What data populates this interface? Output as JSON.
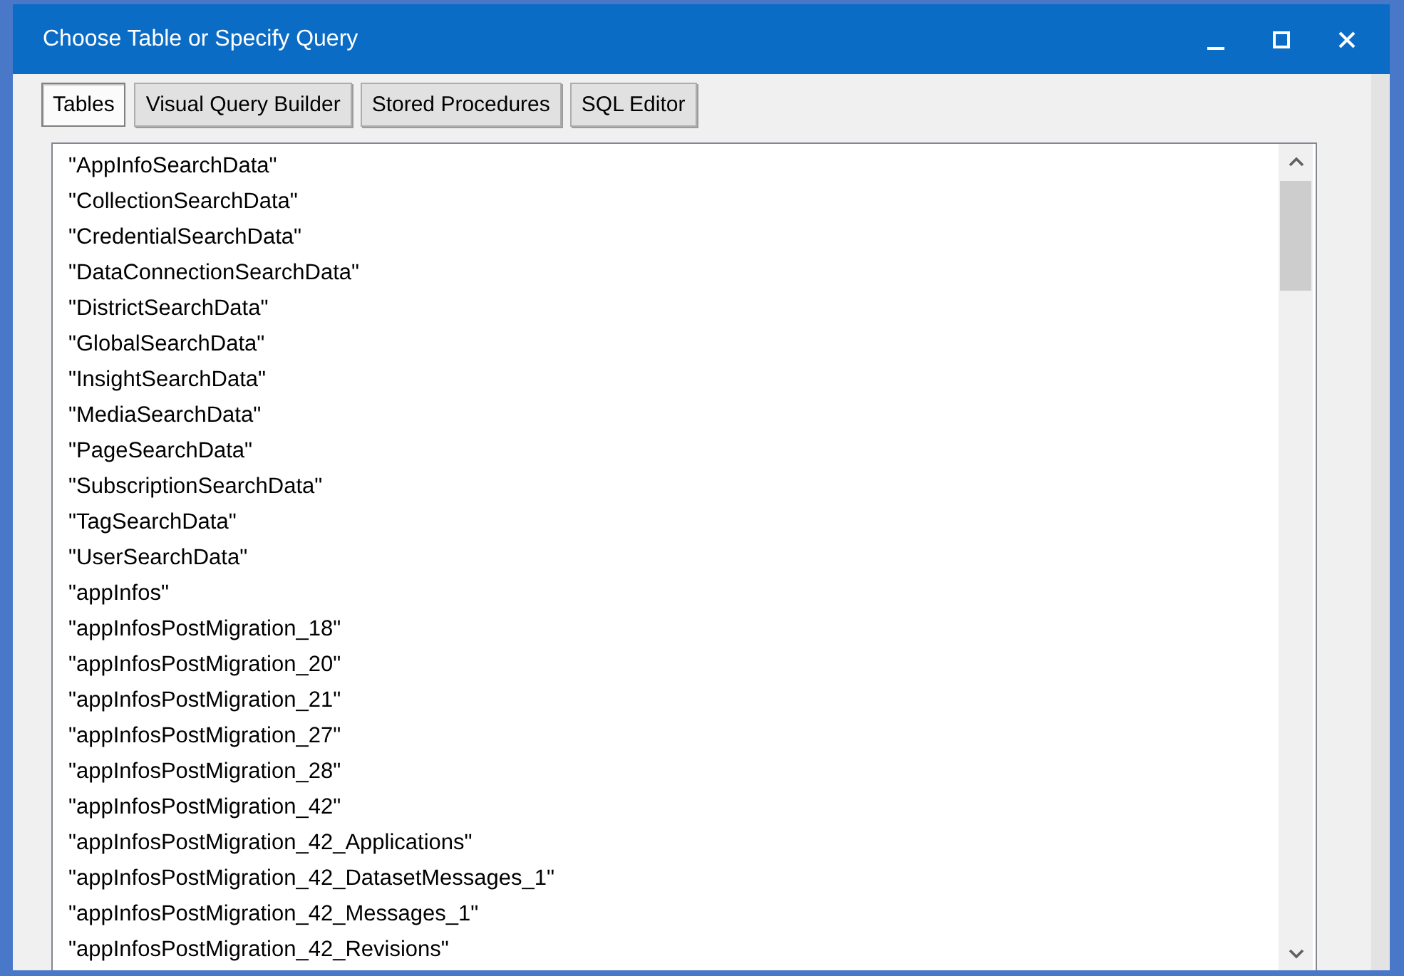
{
  "window": {
    "title": "Choose Table or Specify Query"
  },
  "tabs": [
    {
      "label": "Tables",
      "selected": true
    },
    {
      "label": "Visual Query Builder",
      "selected": false
    },
    {
      "label": "Stored Procedures",
      "selected": false
    },
    {
      "label": "SQL Editor",
      "selected": false
    }
  ],
  "table_list": {
    "items": [
      "\"AppInfoSearchData\"",
      "\"CollectionSearchData\"",
      "\"CredentialSearchData\"",
      "\"DataConnectionSearchData\"",
      "\"DistrictSearchData\"",
      "\"GlobalSearchData\"",
      "\"InsightSearchData\"",
      "\"MediaSearchData\"",
      "\"PageSearchData\"",
      "\"SubscriptionSearchData\"",
      "\"TagSearchData\"",
      "\"UserSearchData\"",
      "\"appInfos\"",
      "\"appInfosPostMigration_18\"",
      "\"appInfosPostMigration_20\"",
      "\"appInfosPostMigration_21\"",
      "\"appInfosPostMigration_27\"",
      "\"appInfosPostMigration_28\"",
      "\"appInfosPostMigration_42\"",
      "\"appInfosPostMigration_42_Applications\"",
      "\"appInfosPostMigration_42_DatasetMessages_1\"",
      "\"appInfosPostMigration_42_Messages_1\"",
      "\"appInfosPostMigration_42_Revisions\""
    ]
  }
}
